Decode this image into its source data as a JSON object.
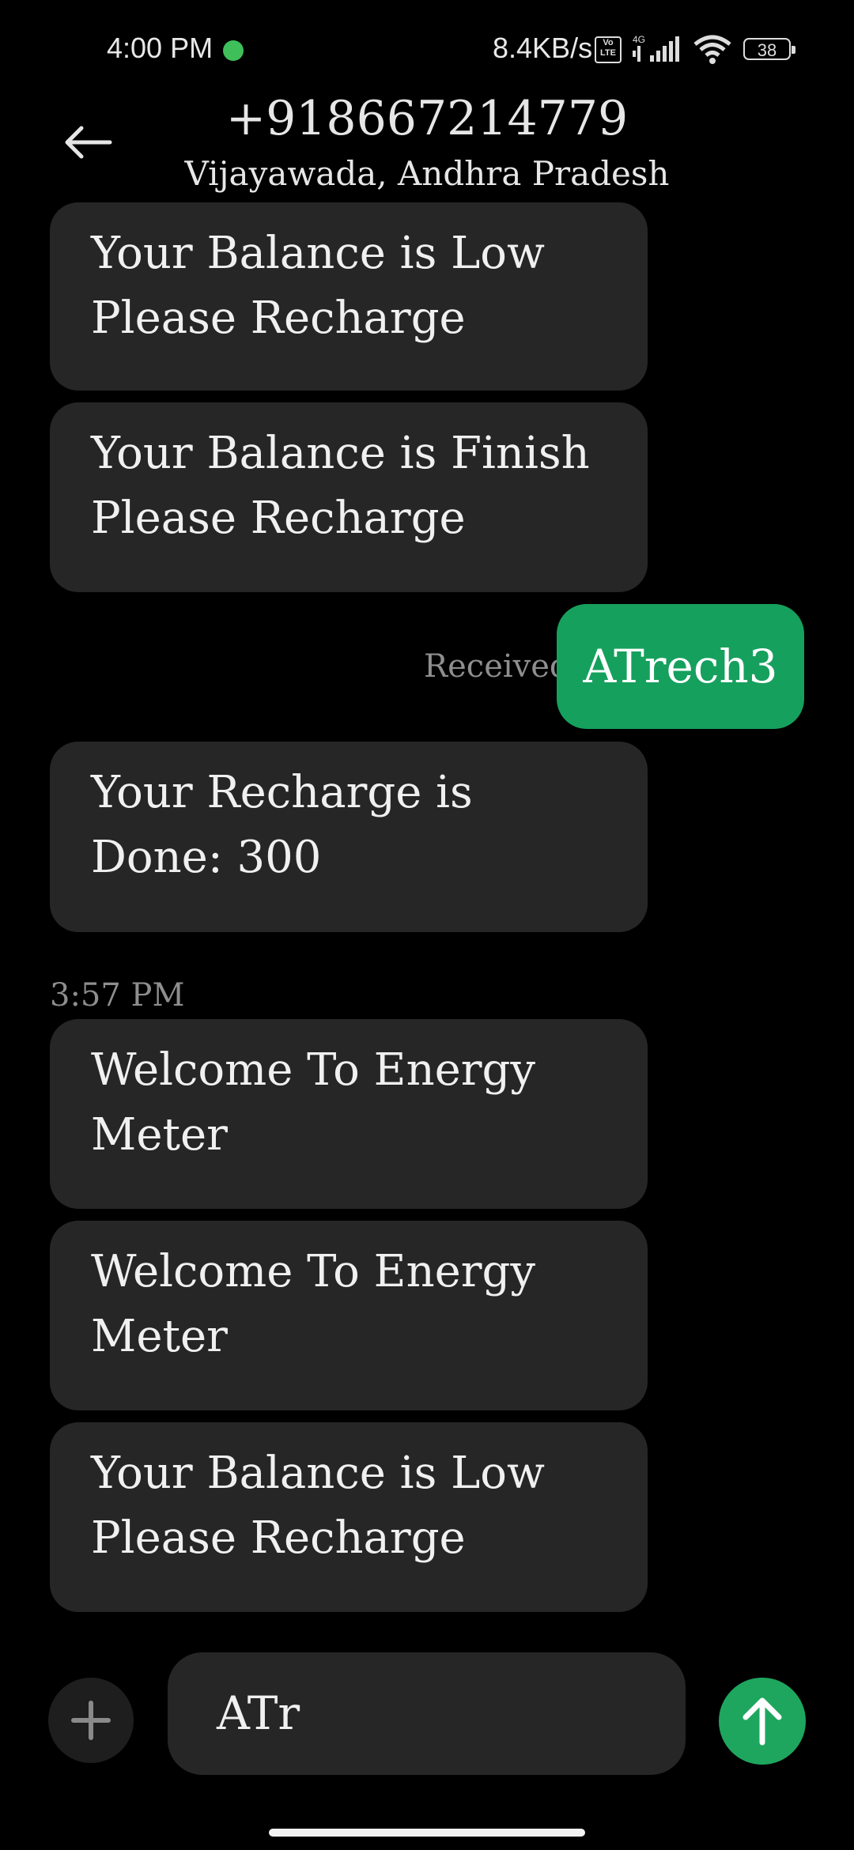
{
  "status_bar": {
    "time": "4:00 PM",
    "net_speed": "8.4KB/s",
    "volte": "Vo LTE",
    "network": "4G",
    "battery": "38"
  },
  "header": {
    "title": "+918667214779",
    "subtitle": "Vijayawada, Andhra Pradesh"
  },
  "messages": {
    "m1": "Your Balance is Low Please Recharge",
    "m2": "Your Balance is Finish Please Recharge",
    "sent": "ATrech3",
    "sent_status": "Received",
    "m3": "Your Recharge is Done: 300",
    "timestamp": "3:57 PM",
    "m4": "Welcome To Energy Meter",
    "m5": "Welcome To Energy Meter",
    "m6": "Your Balance is Low Please Recharge"
  },
  "composer": {
    "value": "ATr"
  },
  "colors": {
    "accent": "#16a05d",
    "bubble": "#262626",
    "background": "#000000"
  }
}
